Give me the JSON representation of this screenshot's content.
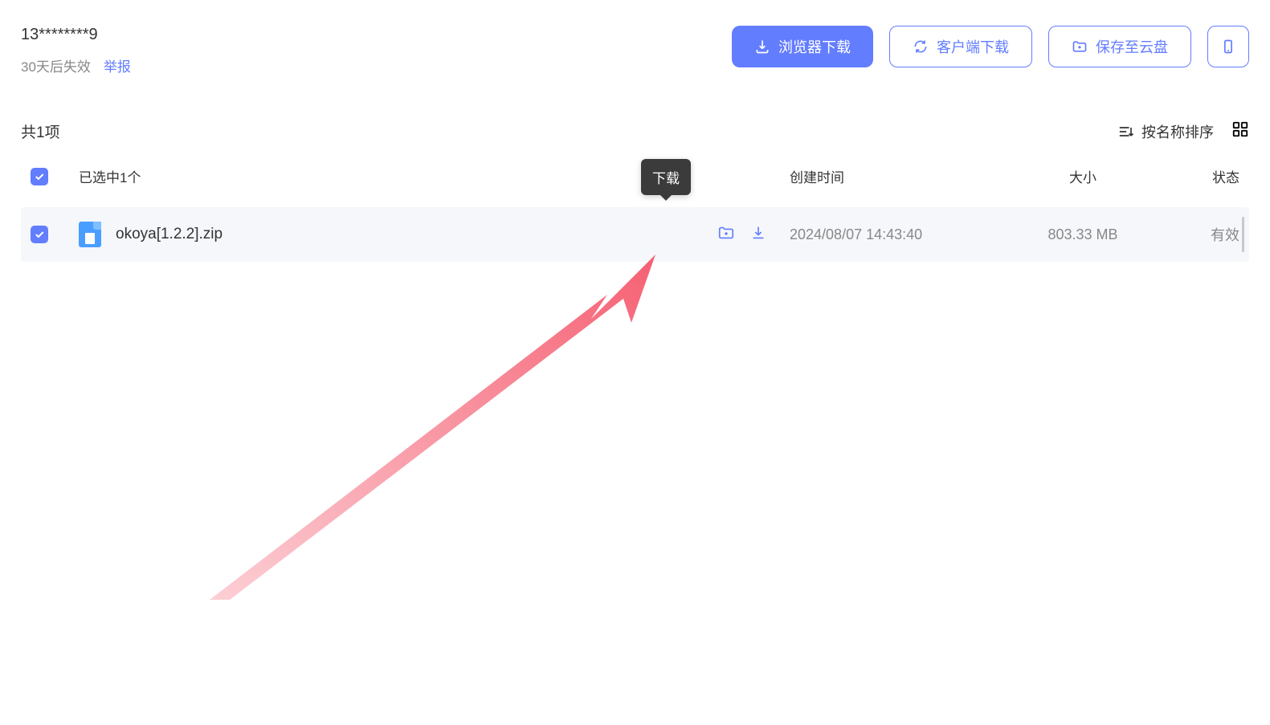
{
  "header": {
    "sharer": "13********9",
    "expire": "30天后失效",
    "report": "举报",
    "buttons": {
      "browserDownload": "浏览器下载",
      "clientDownload": "客户端下载",
      "saveToCloud": "保存至云盘"
    }
  },
  "list": {
    "totalText": "共1项",
    "sortLabel": "按名称排序",
    "selectedText": "已选中1个",
    "columns": {
      "createdTime": "创建时间",
      "size": "大小",
      "status": "状态"
    }
  },
  "file": {
    "name": "okoya[1.2.2].zip",
    "createdTime": "2024/08/07 14:43:40",
    "size": "803.33 MB",
    "status": "有效"
  },
  "tooltip": {
    "download": "下载"
  }
}
